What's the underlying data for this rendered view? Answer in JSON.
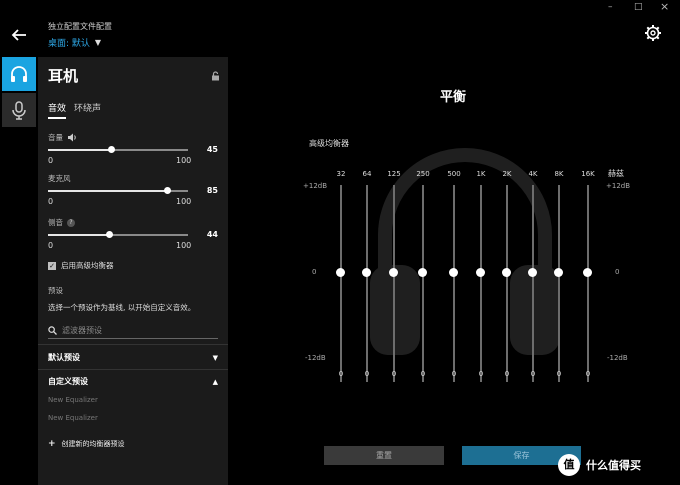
{
  "window": {
    "minimize": "–",
    "maximize": "□",
    "close": "×"
  },
  "profile": {
    "label": "独立配置文件配置",
    "value": "桌面: 默认"
  },
  "panel": {
    "title": "耳机",
    "tabs": [
      {
        "label": "音效"
      },
      {
        "label": "环绕声"
      }
    ],
    "sliders": [
      {
        "label": "音量",
        "value": "45",
        "min": "0",
        "max": "100",
        "level": 45
      },
      {
        "label": "麦克风",
        "value": "85",
        "min": "0",
        "max": "100",
        "level": 85
      },
      {
        "label": "侧音",
        "value": "44",
        "min": "0",
        "max": "100",
        "level": 44
      }
    ],
    "advanced_eq_label": "启用高级均衡器",
    "preset_heading": "预设",
    "preset_desc": "选择一个预设作为基线, 以开始自定义音效。",
    "search_placeholder": "滤波器预设",
    "default_presets": "默认预设",
    "custom_presets": "自定义预设",
    "custom_items": [
      "New Equalizer",
      "New Equalizer"
    ],
    "create_label": "创建新的均衡器预设"
  },
  "main": {
    "title": "平衡",
    "eq_label": "高级均衡器",
    "hz_label": "赫兹",
    "db_top": "+12dB",
    "db_mid": "0",
    "db_bot": "-12dB",
    "bands": [
      {
        "freq": "32",
        "gain": "0"
      },
      {
        "freq": "64",
        "gain": "0"
      },
      {
        "freq": "125",
        "gain": "0"
      },
      {
        "freq": "250",
        "gain": "0"
      },
      {
        "freq": "500",
        "gain": "0"
      },
      {
        "freq": "1K",
        "gain": "0"
      },
      {
        "freq": "2K",
        "gain": "0"
      },
      {
        "freq": "4K",
        "gain": "0"
      },
      {
        "freq": "8K",
        "gain": "0"
      },
      {
        "freq": "16K",
        "gain": "0"
      }
    ],
    "reset_label": "重置",
    "save_label": "保存"
  },
  "watermark": {
    "logo": "值",
    "text": "什么值得买"
  }
}
